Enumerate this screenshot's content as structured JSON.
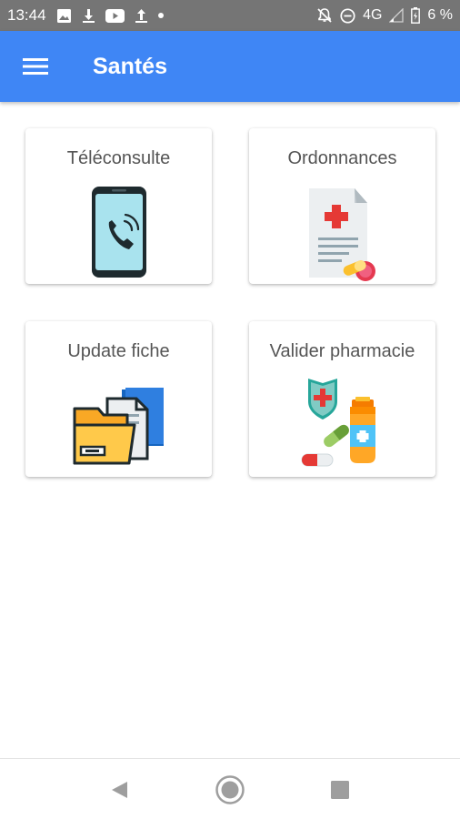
{
  "status_bar": {
    "time": "13:44",
    "network": "4G",
    "battery": "6 %"
  },
  "app_bar": {
    "title": "Santés"
  },
  "cards": [
    {
      "label": "Téléconsulte",
      "icon": "phone-call-icon"
    },
    {
      "label": "Ordonnances",
      "icon": "prescription-icon"
    },
    {
      "label": "Update fiche",
      "icon": "folder-icon"
    },
    {
      "label": "Valider pharmacie",
      "icon": "pharmacy-icon"
    }
  ],
  "colors": {
    "app_bar": "#3f86f5",
    "status_bar": "#757575"
  }
}
